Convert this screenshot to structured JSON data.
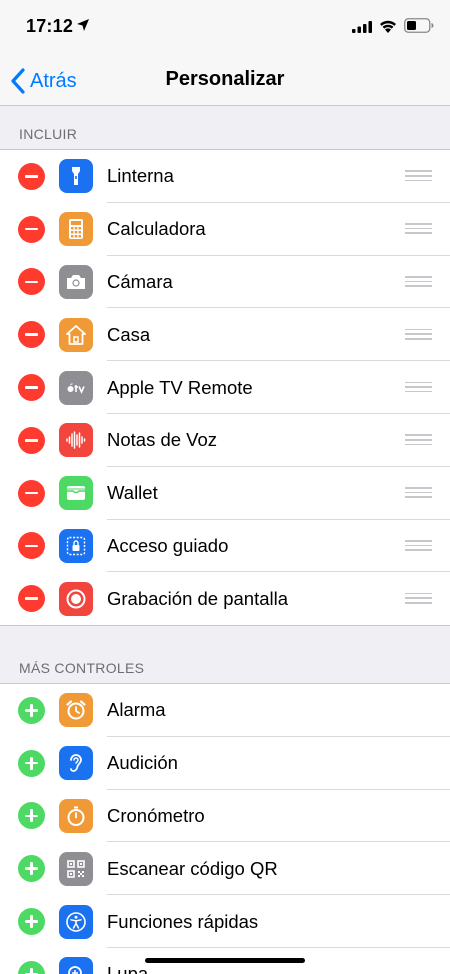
{
  "status": {
    "time": "17:12"
  },
  "nav": {
    "back_label": "Atrás",
    "title": "Personalizar"
  },
  "sections": {
    "include_header": "INCLUIR",
    "more_header": "MÁS CONTROLES"
  },
  "included": [
    {
      "label": "Linterna",
      "icon": "flashlight-icon",
      "color": "#1a72f0"
    },
    {
      "label": "Calculadora",
      "icon": "calculator-icon",
      "color": "#f09a37"
    },
    {
      "label": "Cámara",
      "icon": "camera-icon",
      "color": "#8e8e93"
    },
    {
      "label": "Casa",
      "icon": "home-icon",
      "color": "#f09a37"
    },
    {
      "label": "Apple TV Remote",
      "icon": "apple-tv-icon",
      "color": "#8e8e93"
    },
    {
      "label": "Notas de Voz",
      "icon": "voice-memos-icon",
      "color": "#f1453d"
    },
    {
      "label": "Wallet",
      "icon": "wallet-icon",
      "color": "#4cd964"
    },
    {
      "label": "Acceso guiado",
      "icon": "guided-access-icon",
      "color": "#1a72f0"
    },
    {
      "label": "Grabación de pantalla",
      "icon": "screen-recording-icon",
      "color": "#f1453d"
    }
  ],
  "more": [
    {
      "label": "Alarma",
      "icon": "alarm-icon",
      "color": "#f09a37"
    },
    {
      "label": "Audición",
      "icon": "hearing-icon",
      "color": "#1a72f0"
    },
    {
      "label": "Cronómetro",
      "icon": "stopwatch-icon",
      "color": "#f09a37"
    },
    {
      "label": "Escanear código QR",
      "icon": "qr-code-icon",
      "color": "#8e8e93"
    },
    {
      "label": "Funciones rápidas",
      "icon": "accessibility-icon",
      "color": "#1a72f0"
    },
    {
      "label": "Lupa",
      "icon": "magnifier-icon",
      "color": "#1a72f0"
    }
  ],
  "colors": {
    "accent": "#007aff",
    "remove": "#ff3b30",
    "add": "#4cd964"
  }
}
